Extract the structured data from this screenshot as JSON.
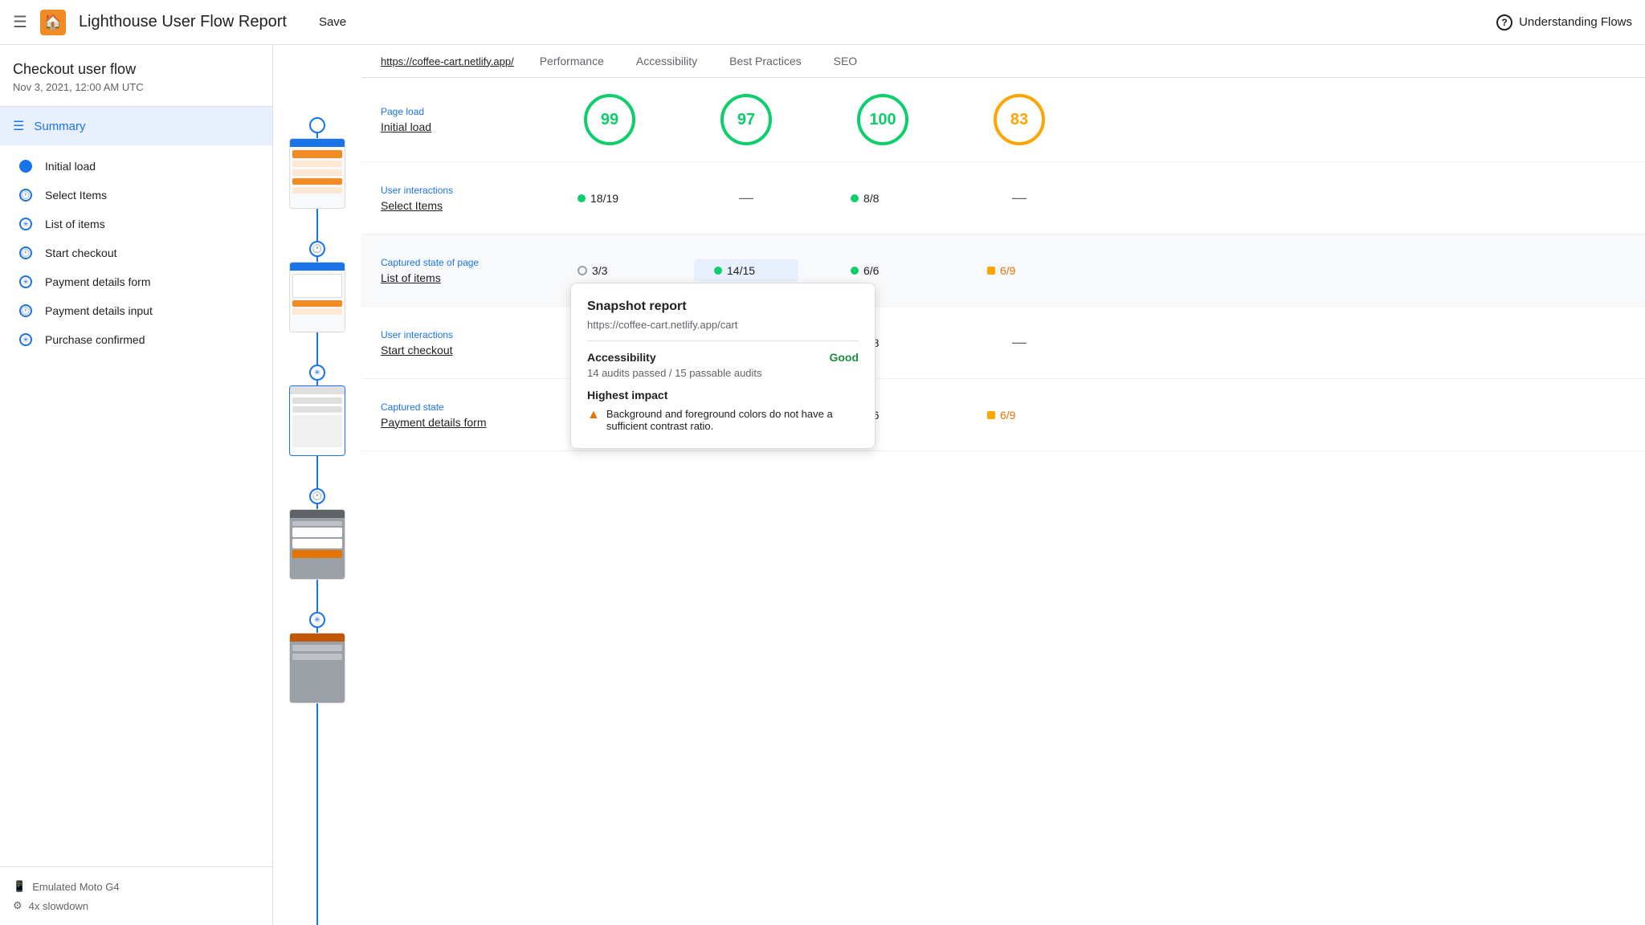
{
  "header": {
    "menu_icon": "≡",
    "logo_icon": "🏠",
    "title": "Lighthouse User Flow Report",
    "save_label": "Save",
    "help_icon": "?",
    "help_label": "Understanding Flows"
  },
  "sidebar": {
    "flow_title": "Checkout user flow",
    "flow_date": "Nov 3, 2021, 12:00 AM UTC",
    "summary_label": "Summary",
    "nav_items": [
      {
        "label": "Initial load",
        "type": "page-load"
      },
      {
        "label": "Select Items",
        "type": "user-interaction"
      },
      {
        "label": "List of items",
        "type": "snapshot"
      },
      {
        "label": "Start checkout",
        "type": "user-interaction"
      },
      {
        "label": "Payment details form",
        "type": "snapshot"
      },
      {
        "label": "Payment details input",
        "type": "user-interaction"
      },
      {
        "label": "Purchase confirmed",
        "type": "snapshot"
      }
    ],
    "device_label": "Emulated Moto G4",
    "slowdown_label": "4x slowdown"
  },
  "content": {
    "url": "https://coffee-cart.netlify.app/",
    "categories": [
      "Performance",
      "Accessibility",
      "Best Practices",
      "SEO"
    ],
    "rows": [
      {
        "type": "Page load",
        "name": "Initial load",
        "scores": {
          "performance": {
            "kind": "circle",
            "value": 99,
            "color": "green"
          },
          "accessibility": {
            "kind": "circle",
            "value": 97,
            "color": "green"
          },
          "best_practices": {
            "kind": "circle",
            "value": 100,
            "color": "green"
          },
          "seo": {
            "kind": "circle",
            "value": 83,
            "color": "orange"
          }
        }
      },
      {
        "type": "User interactions",
        "name": "Select Items",
        "scores": {
          "performance": {
            "kind": "badge",
            "value": "18/19",
            "dot": "green"
          },
          "accessibility": {
            "kind": "dash"
          },
          "best_practices": {
            "kind": "badge",
            "value": "8/8",
            "dot": "green"
          },
          "seo": {
            "kind": "dash"
          }
        }
      },
      {
        "type": "Captured state of page",
        "name": "List of items",
        "highlighted": true,
        "scores": {
          "performance": {
            "kind": "badge-ring",
            "value": "3/3"
          },
          "accessibility": {
            "kind": "badge",
            "value": "14/15",
            "dot": "green"
          },
          "best_practices": {
            "kind": "badge",
            "value": "6/6",
            "dot": "green"
          },
          "seo": {
            "kind": "badge",
            "value": "6/9",
            "dot": "orange"
          }
        }
      },
      {
        "type": "User interactions",
        "name": "Start checkout",
        "scores": {
          "performance": {
            "kind": "dash"
          },
          "accessibility": {
            "kind": "dash"
          },
          "best_practices": {
            "kind": "badge",
            "value": "8/8",
            "dot": "green"
          },
          "seo": {
            "kind": "dash"
          }
        }
      },
      {
        "type": "Captured state",
        "name": "Payment details form",
        "scores": {
          "performance": {
            "kind": "dash"
          },
          "accessibility": {
            "kind": "dash"
          },
          "best_practices": {
            "kind": "badge",
            "value": "6/6",
            "dot": "green"
          },
          "seo": {
            "kind": "badge",
            "value": "6/9",
            "dot": "orange"
          }
        }
      }
    ]
  },
  "tooltip": {
    "title": "Snapshot report",
    "url": "https://coffee-cart.netlify.app/cart",
    "section": "Accessibility",
    "status": "Good",
    "description": "14 audits passed / 15 passable audits",
    "impact_title": "Highest impact",
    "impact_item": "Background and foreground colors do not have a sufficient contrast ratio."
  }
}
